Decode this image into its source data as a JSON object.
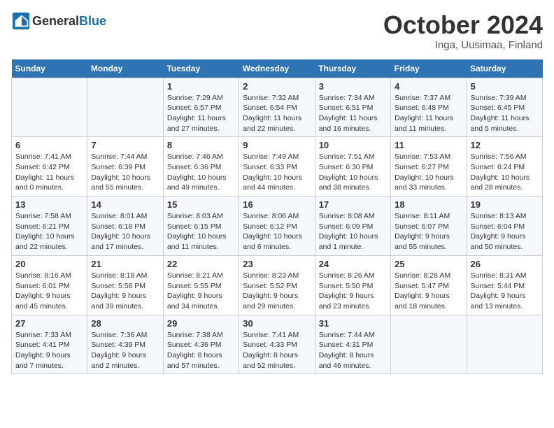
{
  "header": {
    "logo_general": "General",
    "logo_blue": "Blue",
    "title": "October 2024",
    "subtitle": "Inga, Uusimaa, Finland"
  },
  "weekdays": [
    "Sunday",
    "Monday",
    "Tuesday",
    "Wednesday",
    "Thursday",
    "Friday",
    "Saturday"
  ],
  "weeks": [
    [
      {
        "day": "",
        "info": ""
      },
      {
        "day": "",
        "info": ""
      },
      {
        "day": "1",
        "info": "Sunrise: 7:29 AM\nSunset: 6:57 PM\nDaylight: 11 hours and 27 minutes."
      },
      {
        "day": "2",
        "info": "Sunrise: 7:32 AM\nSunset: 6:54 PM\nDaylight: 11 hours and 22 minutes."
      },
      {
        "day": "3",
        "info": "Sunrise: 7:34 AM\nSunset: 6:51 PM\nDaylight: 11 hours and 16 minutes."
      },
      {
        "day": "4",
        "info": "Sunrise: 7:37 AM\nSunset: 6:48 PM\nDaylight: 11 hours and 11 minutes."
      },
      {
        "day": "5",
        "info": "Sunrise: 7:39 AM\nSunset: 6:45 PM\nDaylight: 11 hours and 5 minutes."
      }
    ],
    [
      {
        "day": "6",
        "info": "Sunrise: 7:41 AM\nSunset: 6:42 PM\nDaylight: 11 hours and 0 minutes."
      },
      {
        "day": "7",
        "info": "Sunrise: 7:44 AM\nSunset: 6:39 PM\nDaylight: 10 hours and 55 minutes."
      },
      {
        "day": "8",
        "info": "Sunrise: 7:46 AM\nSunset: 6:36 PM\nDaylight: 10 hours and 49 minutes."
      },
      {
        "day": "9",
        "info": "Sunrise: 7:49 AM\nSunset: 6:33 PM\nDaylight: 10 hours and 44 minutes."
      },
      {
        "day": "10",
        "info": "Sunrise: 7:51 AM\nSunset: 6:30 PM\nDaylight: 10 hours and 38 minutes."
      },
      {
        "day": "11",
        "info": "Sunrise: 7:53 AM\nSunset: 6:27 PM\nDaylight: 10 hours and 33 minutes."
      },
      {
        "day": "12",
        "info": "Sunrise: 7:56 AM\nSunset: 6:24 PM\nDaylight: 10 hours and 28 minutes."
      }
    ],
    [
      {
        "day": "13",
        "info": "Sunrise: 7:58 AM\nSunset: 6:21 PM\nDaylight: 10 hours and 22 minutes."
      },
      {
        "day": "14",
        "info": "Sunrise: 8:01 AM\nSunset: 6:18 PM\nDaylight: 10 hours and 17 minutes."
      },
      {
        "day": "15",
        "info": "Sunrise: 8:03 AM\nSunset: 6:15 PM\nDaylight: 10 hours and 11 minutes."
      },
      {
        "day": "16",
        "info": "Sunrise: 8:06 AM\nSunset: 6:12 PM\nDaylight: 10 hours and 6 minutes."
      },
      {
        "day": "17",
        "info": "Sunrise: 8:08 AM\nSunset: 6:09 PM\nDaylight: 10 hours and 1 minute."
      },
      {
        "day": "18",
        "info": "Sunrise: 8:11 AM\nSunset: 6:07 PM\nDaylight: 9 hours and 55 minutes."
      },
      {
        "day": "19",
        "info": "Sunrise: 8:13 AM\nSunset: 6:04 PM\nDaylight: 9 hours and 50 minutes."
      }
    ],
    [
      {
        "day": "20",
        "info": "Sunrise: 8:16 AM\nSunset: 6:01 PM\nDaylight: 9 hours and 45 minutes."
      },
      {
        "day": "21",
        "info": "Sunrise: 8:18 AM\nSunset: 5:58 PM\nDaylight: 9 hours and 39 minutes."
      },
      {
        "day": "22",
        "info": "Sunrise: 8:21 AM\nSunset: 5:55 PM\nDaylight: 9 hours and 34 minutes."
      },
      {
        "day": "23",
        "info": "Sunrise: 8:23 AM\nSunset: 5:52 PM\nDaylight: 9 hours and 29 minutes."
      },
      {
        "day": "24",
        "info": "Sunrise: 8:26 AM\nSunset: 5:50 PM\nDaylight: 9 hours and 23 minutes."
      },
      {
        "day": "25",
        "info": "Sunrise: 8:28 AM\nSunset: 5:47 PM\nDaylight: 9 hours and 18 minutes."
      },
      {
        "day": "26",
        "info": "Sunrise: 8:31 AM\nSunset: 5:44 PM\nDaylight: 9 hours and 13 minutes."
      }
    ],
    [
      {
        "day": "27",
        "info": "Sunrise: 7:33 AM\nSunset: 4:41 PM\nDaylight: 9 hours and 7 minutes."
      },
      {
        "day": "28",
        "info": "Sunrise: 7:36 AM\nSunset: 4:39 PM\nDaylight: 9 hours and 2 minutes."
      },
      {
        "day": "29",
        "info": "Sunrise: 7:38 AM\nSunset: 4:36 PM\nDaylight: 8 hours and 57 minutes."
      },
      {
        "day": "30",
        "info": "Sunrise: 7:41 AM\nSunset: 4:33 PM\nDaylight: 8 hours and 52 minutes."
      },
      {
        "day": "31",
        "info": "Sunrise: 7:44 AM\nSunset: 4:31 PM\nDaylight: 8 hours and 46 minutes."
      },
      {
        "day": "",
        "info": ""
      },
      {
        "day": "",
        "info": ""
      }
    ]
  ]
}
